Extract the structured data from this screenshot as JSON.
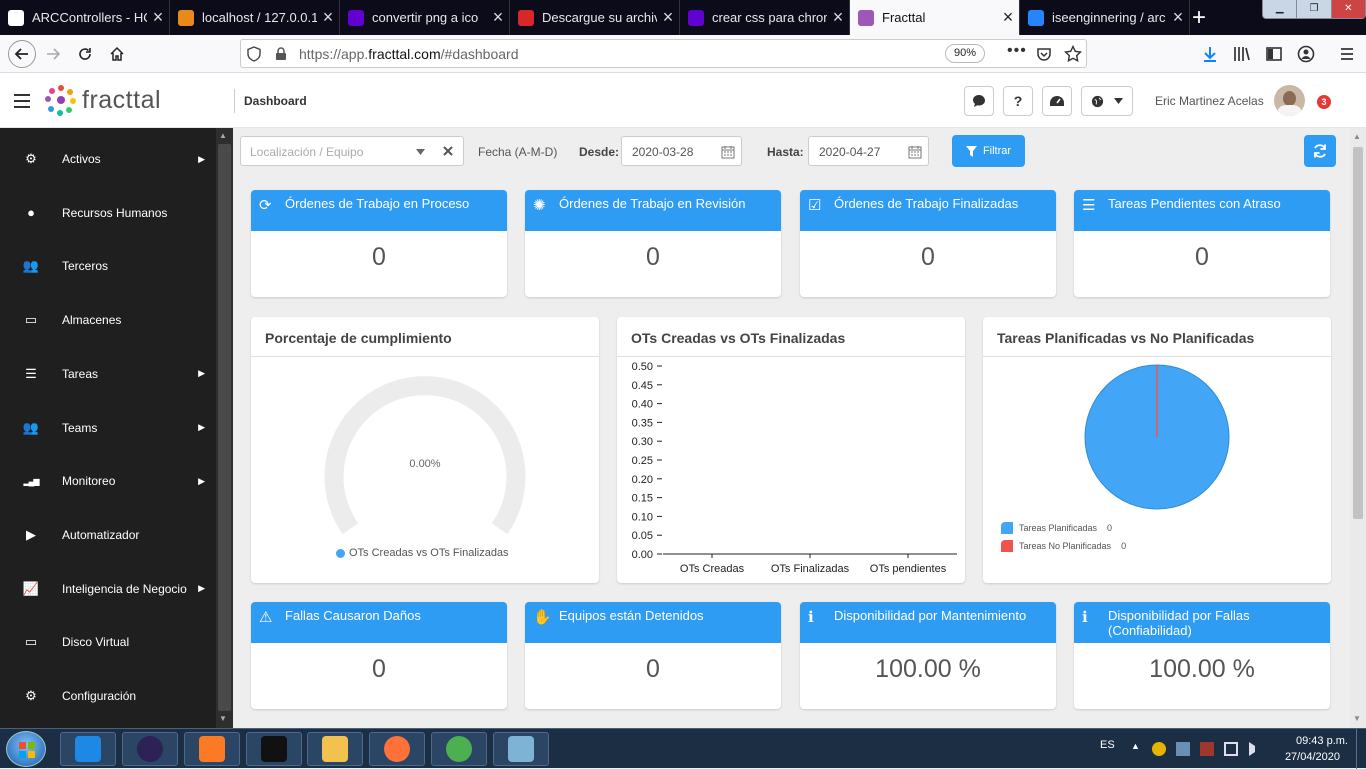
{
  "browser": {
    "tabs": [
      {
        "title": "ARCControllers - HOME",
        "icon": "arc-favicon-icon",
        "color": "#ffffff"
      },
      {
        "title": "localhost / 127.0.0.1",
        "icon": "phpmyadmin-favicon-icon",
        "color": "#e88a1a"
      },
      {
        "title": "convertir png a ico",
        "icon": "yahoo-favicon-icon",
        "color": "#6001d2"
      },
      {
        "title": "Descargue su archivo",
        "icon": "convert-favicon-icon",
        "color": "#d9262c"
      },
      {
        "title": "crear css para chrom",
        "icon": "yahoo-favicon-icon",
        "color": "#6001d2"
      },
      {
        "title": "Fracttal",
        "icon": "fracttal-favicon-icon",
        "color": "#9b59b6"
      },
      {
        "title": "iseenginnering / arc",
        "icon": "bitbucket-favicon-icon",
        "color": "#2684ff"
      }
    ],
    "new_tab": "+",
    "url_prefix": "https://app.",
    "url_domain": "fracttal.com",
    "url_suffix": "/#dashboard",
    "zoom": "90%"
  },
  "header": {
    "logo_text": "fracttal",
    "page_title": "Dashboard",
    "user_name": "Eric Martinez Acelas",
    "notification_count": "3",
    "help_label": "?"
  },
  "sidebar": {
    "items": [
      {
        "label": "Activos",
        "icon": "assets-icon",
        "glyph": "⚙",
        "arrow": true
      },
      {
        "label": "Recursos Humanos",
        "icon": "person-icon",
        "glyph": "●",
        "arrow": false
      },
      {
        "label": "Terceros",
        "icon": "group-icon",
        "glyph": "👥",
        "arrow": false
      },
      {
        "label": "Almacenes",
        "icon": "inbox-icon",
        "glyph": "▭",
        "arrow": false
      },
      {
        "label": "Tareas",
        "icon": "list-icon",
        "glyph": "☰",
        "arrow": true
      },
      {
        "label": "Teams",
        "icon": "teams-icon",
        "glyph": "👥",
        "arrow": true
      },
      {
        "label": "Monitoreo",
        "icon": "signal-icon",
        "glyph": "▂▄▆",
        "arrow": true
      },
      {
        "label": "Automatizador",
        "icon": "play-icon",
        "glyph": "▶",
        "arrow": false
      },
      {
        "label": "Inteligencia de Negocio",
        "icon": "line-chart-icon",
        "glyph": "📈",
        "arrow": true
      },
      {
        "label": "Disco Virtual",
        "icon": "drive-icon",
        "glyph": "▭",
        "arrow": false
      },
      {
        "label": "Configuración",
        "icon": "gear-icon",
        "glyph": "⚙",
        "arrow": false
      }
    ]
  },
  "filters": {
    "location_placeholder": "Localización / Equipo",
    "date_format_label": "Fecha (A-M-D)",
    "from_label": "Desde:",
    "from_value": "2020-03-28",
    "to_label": "Hasta:",
    "to_value": "2020-04-27",
    "filter_button": "Filtrar"
  },
  "kpis_top": [
    {
      "title": "Órdenes de Trabajo en Proceso",
      "value": "0",
      "icon": "refresh-icon",
      "glyph": "⟳"
    },
    {
      "title": "Órdenes de Trabajo en Revisión",
      "value": "0",
      "icon": "spinner-icon",
      "glyph": "✺"
    },
    {
      "title": "Órdenes de Trabajo Finalizadas",
      "value": "0",
      "icon": "checkbox-icon",
      "glyph": "☑"
    },
    {
      "title": "Tareas Pendientes con Atraso",
      "value": "0",
      "icon": "tasks-icon",
      "glyph": "☰"
    }
  ],
  "kpis_bottom": [
    {
      "title": "Fallas Causaron Daños",
      "value": "0",
      "icon": "warning-icon",
      "glyph": "⚠"
    },
    {
      "title": "Equipos están Detenidos",
      "value": "0",
      "icon": "hand-stop-icon",
      "glyph": "✋"
    },
    {
      "title": "Disponibilidad por Mantenimiento",
      "value": "100.00 %",
      "icon": "info-icon",
      "glyph": "ℹ"
    },
    {
      "title": "Disponibilidad por Fallas (Confiabilidad)",
      "value": "100.00 %",
      "icon": "info-icon",
      "glyph": "ℹ"
    }
  ],
  "panels": {
    "gauge_title": "Porcentaje de cumplimiento",
    "gauge_value": "0.00%",
    "gauge_legend": "OTs Creadas vs OTs Finalizadas",
    "bar_title": "OTs Creadas vs OTs Finalizadas",
    "pie_title": "Tareas Planificadas vs No Planificadas"
  },
  "chart_data": [
    {
      "type": "gauge",
      "value": 0.0,
      "label": "0.00%",
      "legend": "OTs Creadas vs OTs Finalizadas",
      "color": "#42a5f5"
    },
    {
      "type": "bar",
      "categories": [
        "OTs Creadas",
        "OTs Finalizadas",
        "OTs pendientes"
      ],
      "values": [
        0,
        0,
        0
      ],
      "ylim": [
        0,
        0.5
      ],
      "yticks": [
        "0.50",
        "0.45",
        "0.40",
        "0.35",
        "0.30",
        "0.25",
        "0.20",
        "0.15",
        "0.10",
        "0.05",
        "0.00"
      ]
    },
    {
      "type": "pie",
      "series": [
        {
          "name": "Tareas Planificadas",
          "value": 0,
          "color": "#42a5f5"
        },
        {
          "name": "Tareas No Planificadas",
          "value": 0,
          "color": "#ef5350"
        }
      ]
    }
  ],
  "taskbar": {
    "apps": [
      {
        "icon": "vscode-icon",
        "color": "#1e88e5"
      },
      {
        "icon": "eclipse-icon",
        "color": "#2c2255"
      },
      {
        "icon": "xampp-icon",
        "color": "#fb7a24"
      },
      {
        "icon": "cmd-icon",
        "color": "#111111"
      },
      {
        "icon": "file-explorer-icon",
        "color": "#f2c14e"
      },
      {
        "icon": "firefox-icon",
        "color": "#ff7139"
      },
      {
        "icon": "chrome-icon",
        "color": "#4caf50"
      },
      {
        "icon": "paint-icon",
        "color": "#7fb3d5"
      }
    ],
    "language": "ES",
    "time": "09:43 p.m.",
    "date": "27/04/2020"
  }
}
